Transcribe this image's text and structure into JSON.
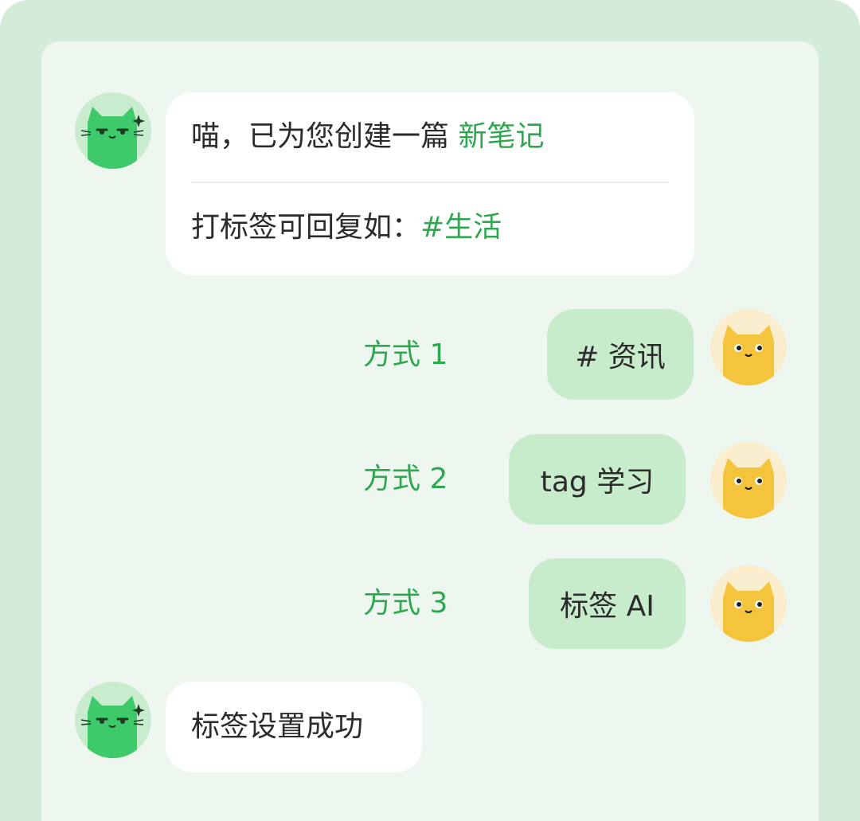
{
  "colors": {
    "outer_bg": "#d3ecd9",
    "panel_bg": "#eef7ef",
    "accent_green": "#2ea84f",
    "user_bubble": "#c8ebcc",
    "bot_avatar": "#3ec96a",
    "user_avatar": "#f4c43d"
  },
  "bot": {
    "avatar_icon": "green-cat-sparkle-icon"
  },
  "user": {
    "avatar_icon": "yellow-cat-icon"
  },
  "messages": {
    "first": {
      "line1_prefix": "喵，已为您创建一篇 ",
      "line1_link": "新笔记",
      "line2_prefix": "打标签可回复如：",
      "line2_tag": "#生活"
    },
    "methods": [
      {
        "label": "方式 1",
        "reply": "# 资讯"
      },
      {
        "label": "方式 2",
        "reply": "tag 学习"
      },
      {
        "label": "方式 3",
        "reply": "标签 AI"
      }
    ],
    "final": {
      "text": "标签设置成功"
    }
  }
}
